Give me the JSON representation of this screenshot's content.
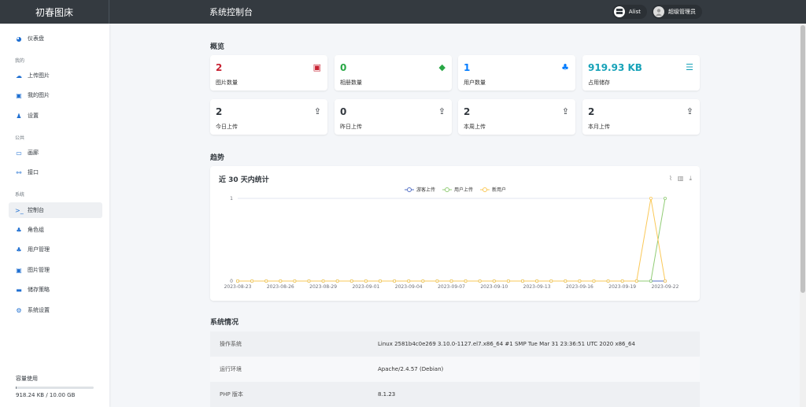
{
  "app": {
    "brand": "初春图床",
    "title": "系统控制台"
  },
  "header": {
    "alist_label": "Alist",
    "user_label": "超级管理员"
  },
  "sidebar": {
    "dashboard": "仪表盘",
    "group_mine": "我的",
    "upload": "上传图片",
    "my_images": "我的图片",
    "settings": "设置",
    "group_public": "公共",
    "gallery": "画廊",
    "api": "接口",
    "group_system": "系统",
    "console": "控制台",
    "roles": "角色组",
    "users": "用户管理",
    "images": "图片管理",
    "storage": "储存策略",
    "system_settings": "系统设置",
    "capacity_label": "容量使用",
    "capacity_text": "918.24 KB / 10.00 GB",
    "capacity_fraction": 9e-05
  },
  "overview": {
    "title": "概览",
    "cards": [
      {
        "value": "2",
        "label": "图片数量",
        "icon": "images-icon",
        "color": "#c82333"
      },
      {
        "value": "0",
        "label": "相册数量",
        "icon": "tags-icon",
        "color": "#28a745"
      },
      {
        "value": "1",
        "label": "用户数量",
        "icon": "users-icon",
        "color": "#007bff"
      },
      {
        "value": "919.93 KB",
        "label": "占用储存",
        "icon": "server-icon",
        "color": "#17a2b8"
      },
      {
        "value": "2",
        "label": "今日上传",
        "icon": "upload-icon",
        "color": "#343a40"
      },
      {
        "value": "0",
        "label": "昨日上传",
        "icon": "upload-icon",
        "color": "#343a40"
      },
      {
        "value": "2",
        "label": "本周上传",
        "icon": "upload-icon",
        "color": "#343a40"
      },
      {
        "value": "2",
        "label": "本月上传",
        "icon": "upload-icon",
        "color": "#343a40"
      }
    ]
  },
  "trend": {
    "title": "趋势"
  },
  "chart_data": {
    "type": "line",
    "title": "近 30 天内统计",
    "x": [
      "2023-08-23",
      "2023-08-24",
      "2023-08-25",
      "2023-08-26",
      "2023-08-27",
      "2023-08-28",
      "2023-08-29",
      "2023-08-30",
      "2023-08-31",
      "2023-09-01",
      "2023-09-02",
      "2023-09-03",
      "2023-09-04",
      "2023-09-05",
      "2023-09-06",
      "2023-09-07",
      "2023-09-08",
      "2023-09-09",
      "2023-09-10",
      "2023-09-11",
      "2023-09-12",
      "2023-09-13",
      "2023-09-14",
      "2023-09-15",
      "2023-09-16",
      "2023-09-17",
      "2023-09-18",
      "2023-09-19",
      "2023-09-20",
      "2023-09-21",
      "2023-09-22"
    ],
    "x_tick_labels": [
      "2023-08-23",
      "2023-08-26",
      "2023-08-29",
      "2023-09-01",
      "2023-09-04",
      "2023-09-07",
      "2023-09-10",
      "2023-09-13",
      "2023-09-16",
      "2023-09-19",
      "2023-09-22"
    ],
    "series": [
      {
        "name": "游客上传",
        "color": "#5470c6",
        "values": [
          0,
          0,
          0,
          0,
          0,
          0,
          0,
          0,
          0,
          0,
          0,
          0,
          0,
          0,
          0,
          0,
          0,
          0,
          0,
          0,
          0,
          0,
          0,
          0,
          0,
          0,
          0,
          0,
          0,
          0,
          0
        ]
      },
      {
        "name": "用户上传",
        "color": "#91cc75",
        "values": [
          0,
          0,
          0,
          0,
          0,
          0,
          0,
          0,
          0,
          0,
          0,
          0,
          0,
          0,
          0,
          0,
          0,
          0,
          0,
          0,
          0,
          0,
          0,
          0,
          0,
          0,
          0,
          0,
          0,
          0,
          1
        ]
      },
      {
        "name": "新用户",
        "color": "#fac858",
        "values": [
          0,
          0,
          0,
          0,
          0,
          0,
          0,
          0,
          0,
          0,
          0,
          0,
          0,
          0,
          0,
          0,
          0,
          0,
          0,
          0,
          0,
          0,
          0,
          0,
          0,
          0,
          0,
          0,
          0,
          1,
          0
        ]
      }
    ],
    "y_ticks": [
      "0",
      "1"
    ],
    "ylim": [
      0,
      1
    ],
    "legend": "top-center",
    "grid": true
  },
  "system": {
    "title": "系统情况",
    "rows": [
      {
        "key": "操作系统",
        "value": "Linux 2581b4c0e269 3.10.0-1127.el7.x86_64 #1 SMP Tue Mar 31 23:36:51 UTC 2020 x86_64"
      },
      {
        "key": "运行环境",
        "value": "Apache/2.4.57 (Debian)"
      },
      {
        "key": "PHP 版本",
        "value": "8.1.23"
      }
    ]
  }
}
